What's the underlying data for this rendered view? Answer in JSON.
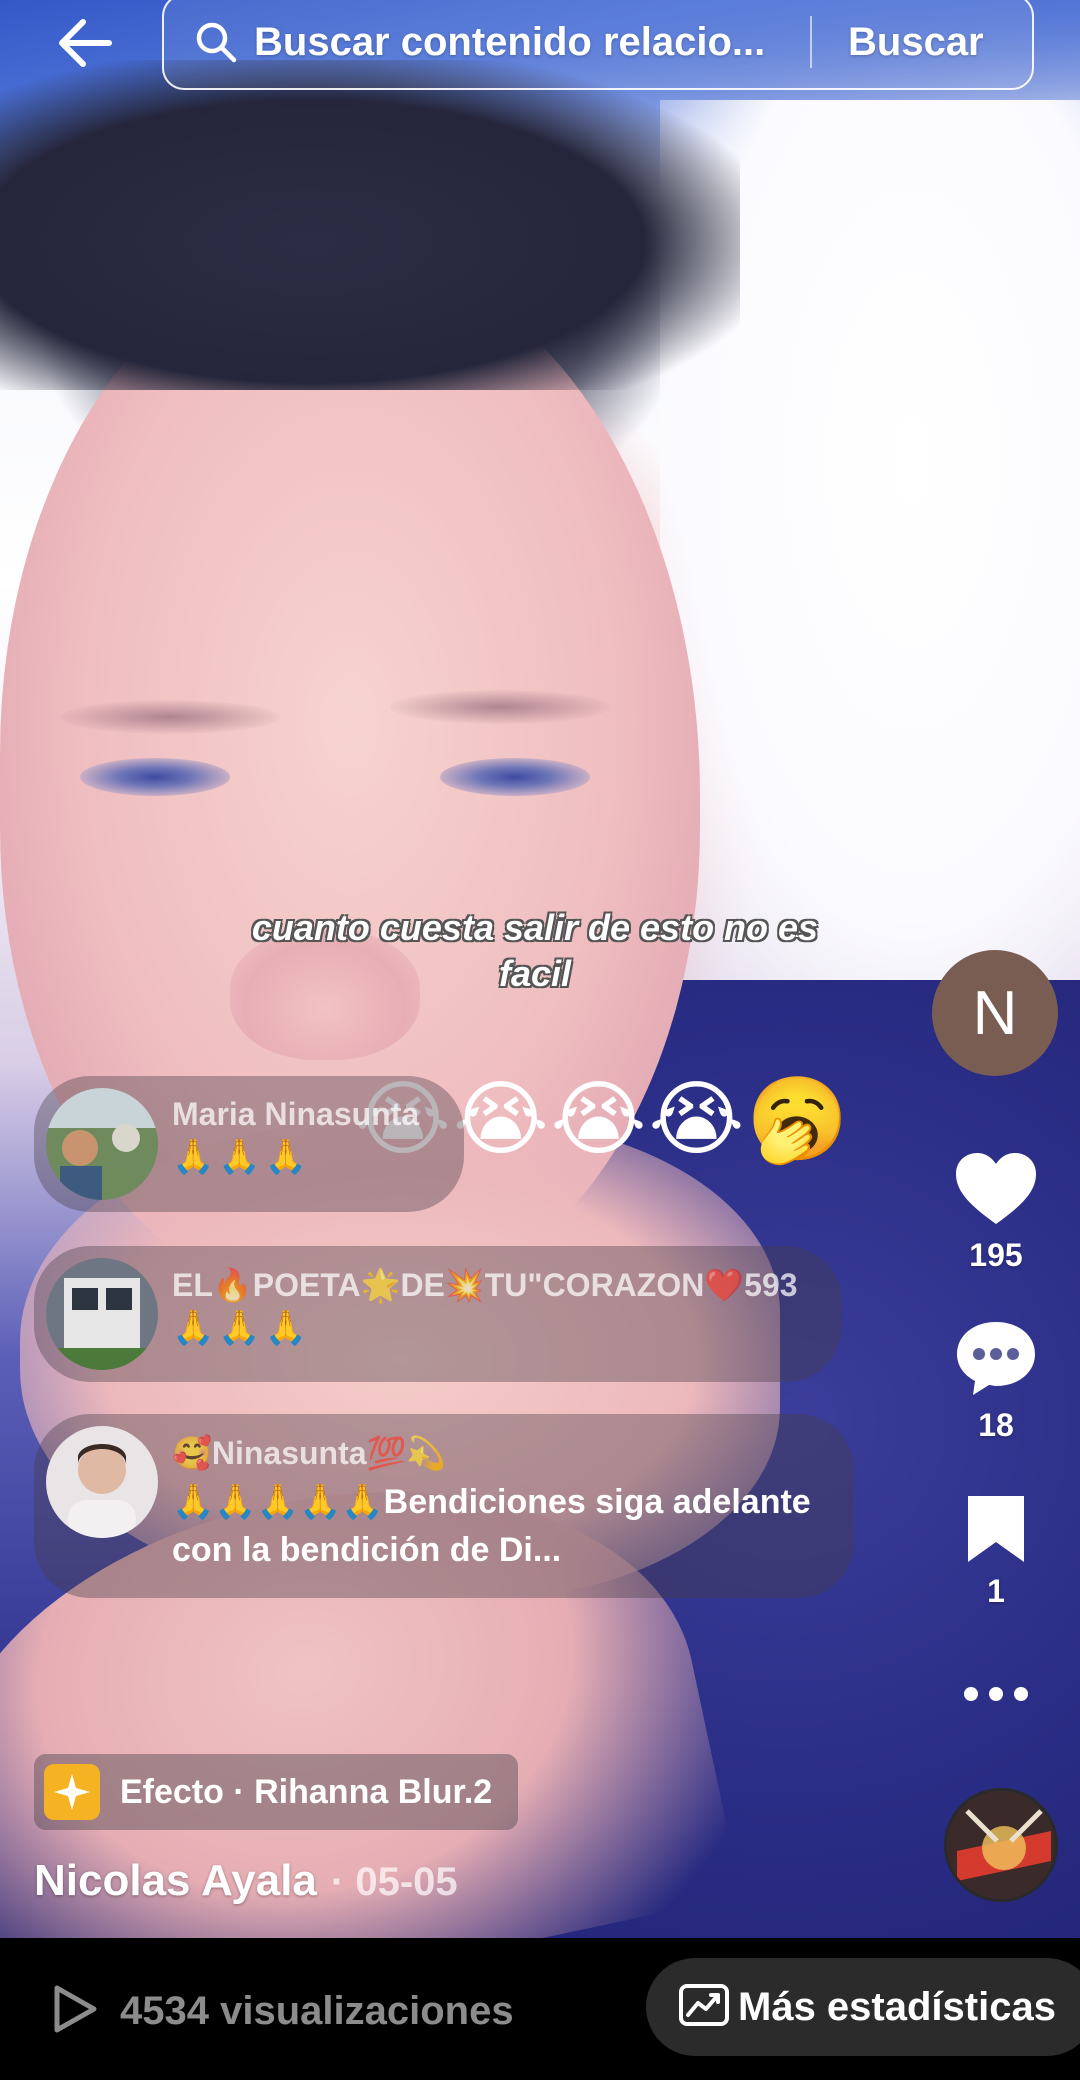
{
  "search": {
    "query": "Buscar contenido relacio...",
    "button_label": "Buscar"
  },
  "video": {
    "caption": "cuanto cuesta salir de esto no es facil"
  },
  "rail": {
    "creator_initial": "N",
    "likes": "195",
    "comments": "18",
    "saves": "1"
  },
  "comments": [
    {
      "author": "Maria Ninasunta",
      "text": "🙏🙏🙏",
      "overlay_emojis": "😭😭😭😭🥱"
    },
    {
      "author": "EL🔥POETA🌟DE💥TU\"CORAZON❤️593",
      "text": "🙏🙏🙏"
    },
    {
      "author": "🥰Ninasunta💯💫",
      "text": "🙏🙏🙏🙏🙏Bendiciones siga adelante con la bendición de Di..."
    }
  ],
  "effect": {
    "label": "Efecto · Rihanna Blur.2"
  },
  "post": {
    "author": "Nicolas Ayala",
    "date": "· 05-05"
  },
  "footer": {
    "views": "4534 visualizaciones",
    "stats_label": "Más estadísticas"
  },
  "icons": {
    "back": "arrow-left-icon",
    "search": "search-icon",
    "like": "heart-icon",
    "comment": "comment-bubble-icon",
    "save": "bookmark-icon",
    "more": "more-dots-icon",
    "play": "play-icon",
    "stats": "trend-chart-icon"
  }
}
